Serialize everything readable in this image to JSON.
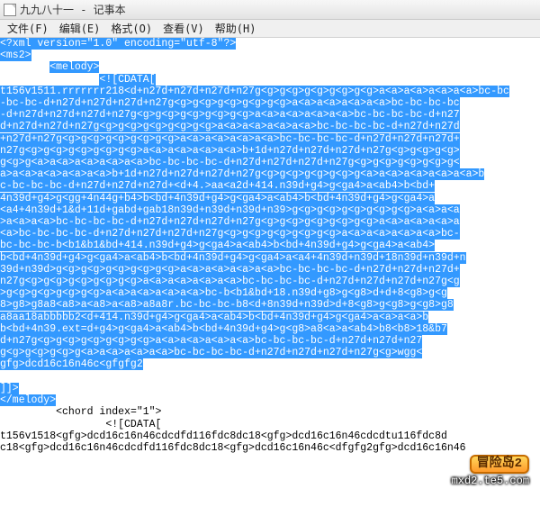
{
  "window": {
    "title": "九九八十一 - 记事本"
  },
  "menu": {
    "file": "文件(F)",
    "edit": "编辑(E)",
    "format": "格式(O)",
    "view": "查看(V)",
    "help": "帮助(H)"
  },
  "editor": {
    "sel_l1": "<?xml version=\"1.0\" encoding=\"utf-8\"?>",
    "sel_l2": "<ms2>",
    "sel_l3_indent": "        ",
    "sel_l3": "<melody>",
    "sel_l4_indent": "                ",
    "sel_l4": "<![CDATA[",
    "sel_block": "t156v1511.rrrrrrr218<d+n27d+n27d+n27d+n27g<g>g<g>g<g>g<g>g<g>a<a>a<a>a<a>a<a>bc-bc\n-bc-bc-d+n27d+n27d+n27d+n27g<g>g<g>g<g>g<g>g<g>a<a>a<a>a<a>a<a>bc-bc-bc-bc\n-d+n27d+n27d+n27d+n27g<g>g<g>g<g>g<g>g<g>a<a>a<a>a<a>a<a>bc-bc-bc-bc-d+n27\nd+n27d+n27d+n27g<g>g<g>g<g>g<g>g<g>a<a>a<a>a<a>a<a>bc-bc-bc-bc-d+n27d+n27d\n+n27d+n27g<g>g<g>g<g>g<g>g<g>a<a>a<a>a<a>a<a>bc-bc-bc-bc-d+n27d+n27d+n27d+\nn27g<g>g<g>g<g>g<g>g<g>a<a>a<a>a<a>a<a>b+1d+n27d+n27d+n27d+n27g<g>g<g>g<g>\ng<g>g<a>a<a>a<a>a<a>a<a>bc-bc-bc-bc-d+n27d+n27d+n27d+n27g<g>g<g>g<g>g<g>g<\na>a<a>a<a>a<a>a<a>b+1d+n27d+n27d+n27d+n27g<g>g<g>g<g>g<g>g<a>a<a>a<a>a<a>a<a>b\nc-bc-bc-bc-d+n27d+n27d+n27d+<d+4.>aa<a2d+414.n39d+g4>g<ga4>a<ab4>b<bd+\n4n39d+g4>g<gg+4n44g+b4>b<bd+4n39d+g4>g<ga4>a<ab4>b<bd+4n39d+g4>g<ga4>a\n<a4+4n39d+1&d+11d+gabd+gab18n39d+n39d+n39d+n39>g<g>g<g>g<g>g<g>g<g>a<a>a<a\n>a<a>a<a>bc-bc-bc-bc-d+n27d+n27d+n27d+n27g<g>g<g>g<g>g<g>g<g>a<a>a<a>a<a>a\n<a>bc-bc-bc-bc-d+n27d+n27d+n27d+n27g<g>g<g>g<g>g<g>g<g>a<a>a<a>a<a>a<a>bc-\nbc-bc-bc-b<b1&b1&bd+414.n39d+g4>g<ga4>a<ab4>b<bd+4n39d+g4>g<ga4>a<ab4>\nb<bd+4n39d+g4>g<ga4>a<ab4>b<bd+4n39d+g4>g<ga4>a<a4+4n39d+n39d+18n39d+n39d+n\n39d+n39d>g<g>g<g>g<g>g<g>g<g>a<a>a<a>a<a>a<a>bc-bc-bc-bc-d+n27d+n27d+n27d+\nn27g<g>g<g>g<g>g<g>g<g>a<a>a<a>a<a>a<a>bc-bc-bc-bc-d+n27d+n27d+n27d+n27g<g\n>g<g>g<g>g<g>g<g>a<a>a<a>a<a>a<a>bc-b<b1&bd+18.n39d+g8>g<g8>d+d+8<g8>g<g\n8>g8>g8a8<a8>a<a8>a<a8>a8a8r.bc-bc-bc-b8<d+8n39d+n39d>d+8<g8>g<g8>g<g8>g8\na8aa18abbbbb2<d+414.n39d+g4>g<ga4>a<ab4>b<bd+4n39d+g4>g<ga4>a<a>a<a>b\nb<bd+4n39.ext=d+g4>g<ga4>a<ab4>b<bd+4n39d+g4>g<g8>a8<a>a<ab4>b8<b8>18&b7\nd+n27g<g>g<g>g<g>g<g>g<g>a<a>a<a>a<a>a<a>bc-bc-bc-bc-d+n27d+n27d+n27\ng<g>g<g>g<g>g<a>a<a>a<a>a<a>bc-bc-bc-bc-d+n27d+n27d+n27d+n27g<g>wgg<\ngfg>dcd16c16n46c<gfgfg2",
    "sel_end_l1": "]]>",
    "sel_end_l2": "</melody>",
    "plain_l1_indent": "         ",
    "plain_l1": "<chord index=\"1\">",
    "plain_l2_indent": "                 ",
    "plain_l2": "<![CDATA[",
    "plain_block": "t156v1518<gfg>dcd16c16n46cdcdfd116fdc8dc18<gfg>dcd16c16n46cdcdtu116fdc8d\nc18<gfg>dcd16c16n46cdcdfd116fdc8dc18<gfg>dcd16c16n46c<dfgfg2gfg>dcd16c16n46"
  },
  "watermark": {
    "badge": "冒险岛2",
    "url": "mxd2.te5.com"
  }
}
